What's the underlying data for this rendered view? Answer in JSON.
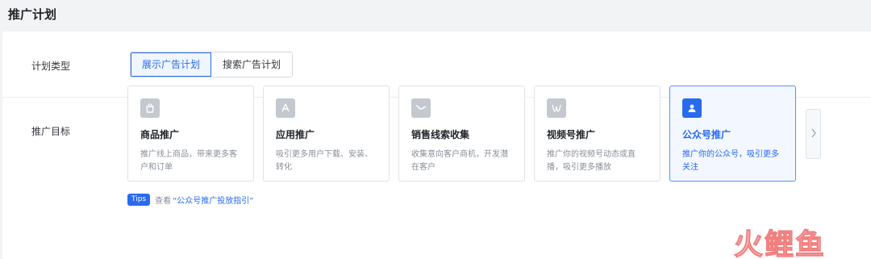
{
  "page": {
    "title": "推广计划"
  },
  "plan_type": {
    "label": "计划类型",
    "options": [
      {
        "label": "展示广告计划",
        "selected": true
      },
      {
        "label": "搜索广告计划",
        "selected": false
      }
    ]
  },
  "goal": {
    "label": "推广目标",
    "cards": [
      {
        "title": "商品推广",
        "desc": "推广线上商品，带来更多客户和订单",
        "icon": "shopping-bag-icon",
        "selected": false
      },
      {
        "title": "应用推广",
        "desc": "吸引更多用户下载、安装、转化",
        "icon": "app-store-icon",
        "selected": false
      },
      {
        "title": "销售线索收集",
        "desc": "收集意向客户商机，开发潜在客户",
        "icon": "trend-line-icon",
        "selected": false
      },
      {
        "title": "视频号推广",
        "desc": "推广你的视频号动态或直播，吸引更多播放",
        "icon": "channels-icon",
        "selected": false
      },
      {
        "title": "公众号推广",
        "desc": "推广你的公众号，吸引更多关注",
        "icon": "user-profile-icon",
        "selected": true
      }
    ],
    "next_icon": "chevron-right-icon"
  },
  "tips": {
    "badge": "Tips",
    "text": "查看",
    "link": "“公众号推广投放指引”"
  },
  "watermark": {
    "text": "火鲤鱼"
  },
  "colors": {
    "accent": "#296bef",
    "selected_bg": "#f3f7ff",
    "watermark": "#f06a6a"
  }
}
